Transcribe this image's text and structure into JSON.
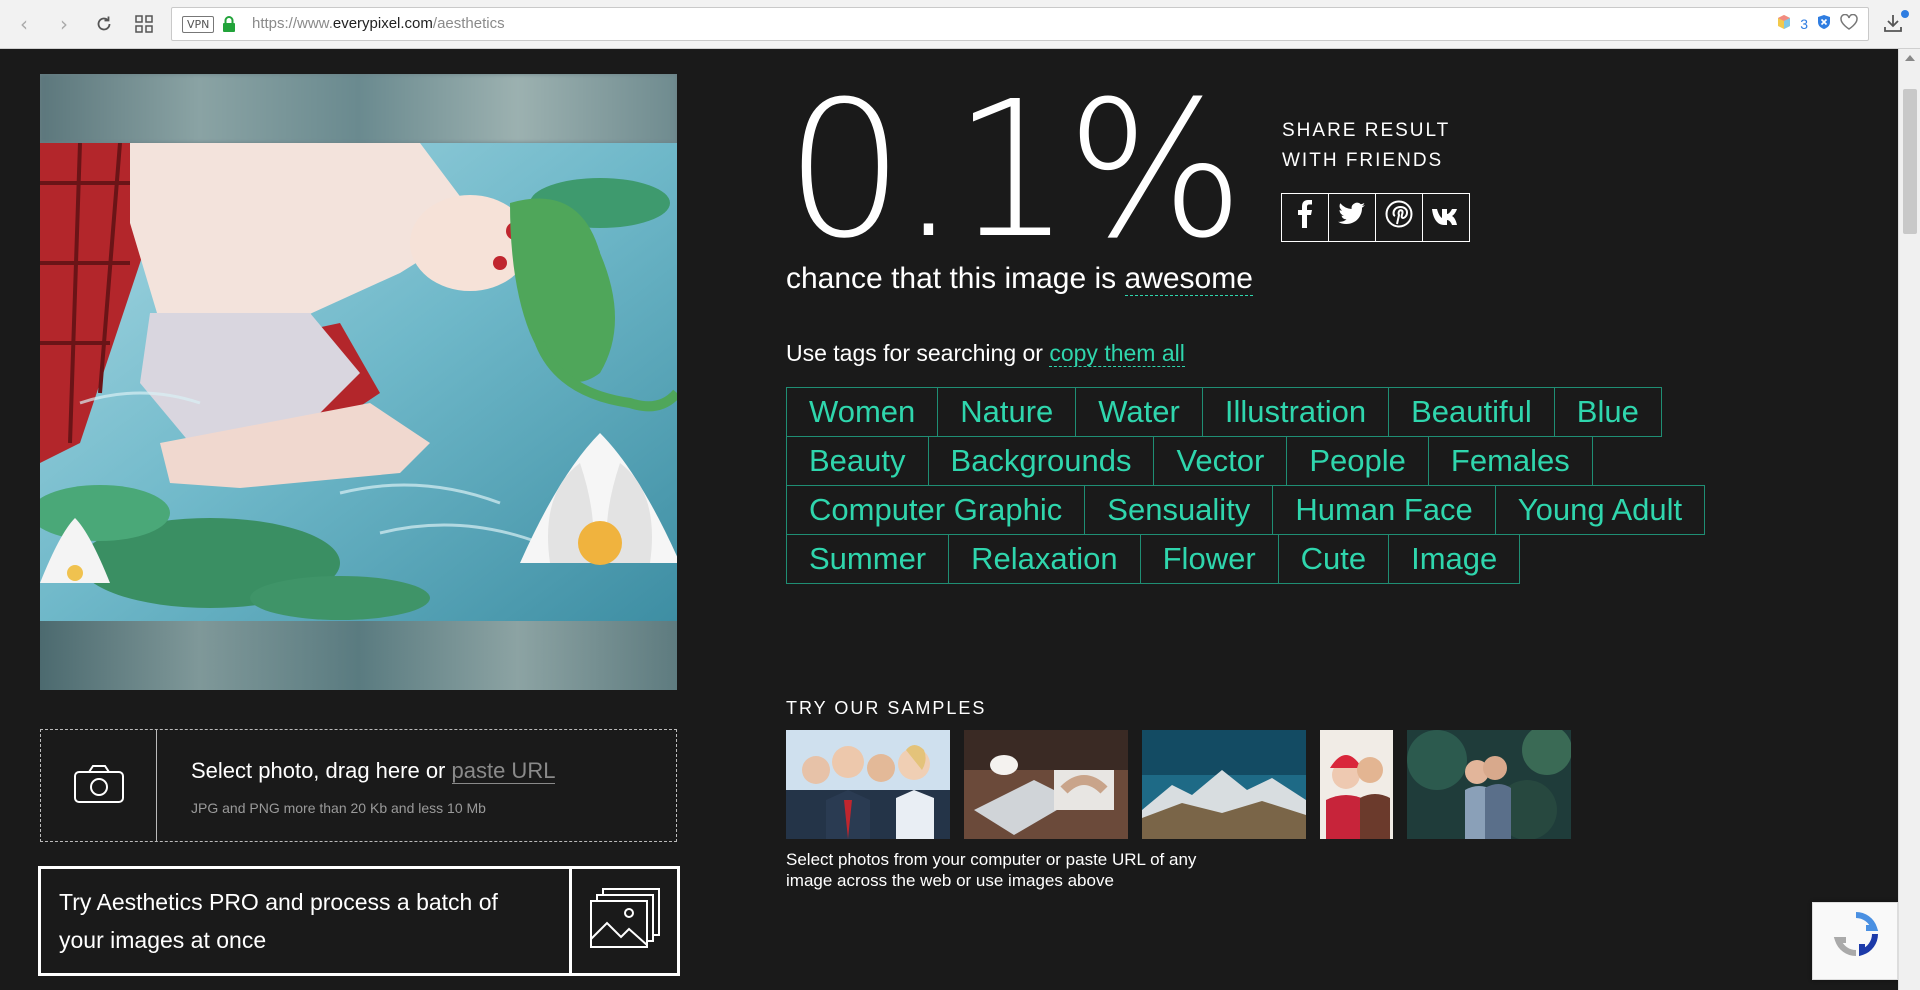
{
  "browser": {
    "vpn_label": "VPN",
    "url_prefix": "https://www.",
    "url_host": "everypixel.com",
    "url_path": "/aesthetics",
    "ext_count": "3"
  },
  "result": {
    "score": "0.1%",
    "chance_prefix": "chance that this image is ",
    "chance_word": "awesome"
  },
  "share": {
    "title": "SHARE RESULT\nWITH FRIENDS",
    "icons": [
      "f",
      "twitter",
      "pinterest",
      "vk"
    ]
  },
  "tags": {
    "lead": "Use tags for searching or ",
    "copy_label": "copy them all",
    "rows": [
      [
        "Women",
        "Nature",
        "Water",
        "Illustration",
        "Beautiful",
        "Blue"
      ],
      [
        "Beauty",
        "Backgrounds",
        "Vector",
        "People",
        "Females"
      ],
      [
        "Computer Graphic",
        "Sensuality",
        "Human Face",
        "Young Adult"
      ],
      [
        "Summer",
        "Relaxation",
        "Flower",
        "Cute",
        "Image"
      ]
    ]
  },
  "upload": {
    "main": "Select photo, drag here or ",
    "paste_label": "paste URL",
    "sub": "JPG and PNG more than 20 Kb and less 10 Mb"
  },
  "pro": {
    "text": "Try Aesthetics PRO and process a batch of your images at once"
  },
  "samples": {
    "title": "TRY OUR SAMPLES",
    "note": "Select photos from your computer or paste URL of any image across the web or use images above"
  },
  "colors": {
    "accent": "#2fd6ad",
    "tag_border": "#1f8e74",
    "background": "#1a1a1a"
  }
}
